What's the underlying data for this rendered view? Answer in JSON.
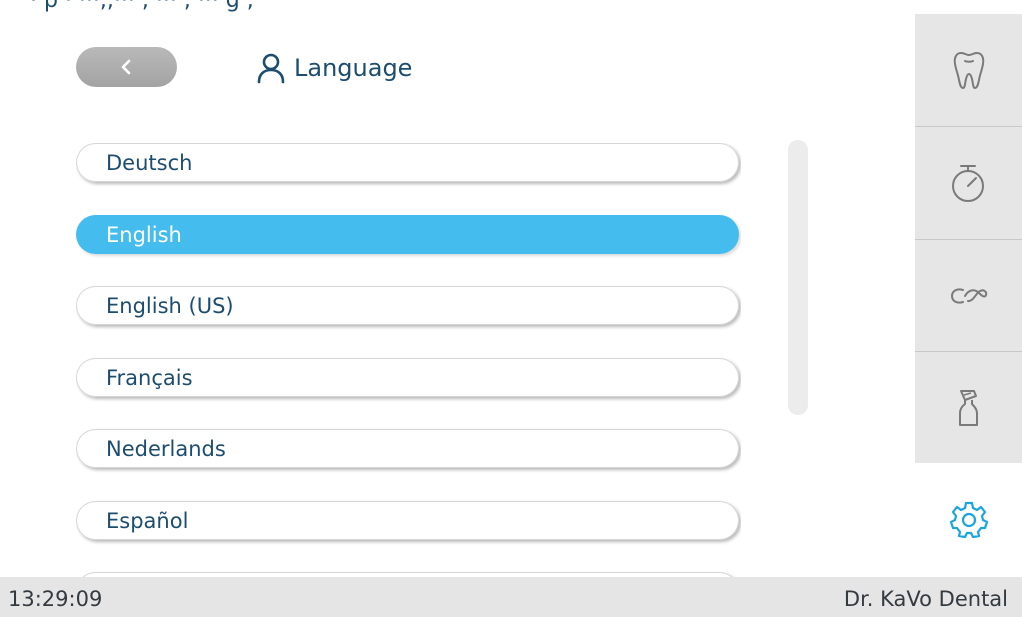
{
  "top_cut_text": "· p · ···,,··· , ··· , ··· g ,",
  "header": {
    "back_icon": "chevron-left-icon",
    "title_icon": "person-icon",
    "title": "Language"
  },
  "languages": [
    {
      "label": "Deutsch",
      "selected": false
    },
    {
      "label": "English",
      "selected": true
    },
    {
      "label": "English (US)",
      "selected": false
    },
    {
      "label": "Français",
      "selected": false
    },
    {
      "label": "Nederlands",
      "selected": false
    },
    {
      "label": "Español",
      "selected": false
    }
  ],
  "sidebar": {
    "items": [
      "tooth-icon",
      "stopwatch-icon",
      "instrument-hose-icon",
      "spray-bottle-icon"
    ],
    "active": "gear-icon"
  },
  "status_bar": {
    "time": "13:29:09",
    "user": "Dr. KaVo Dental"
  },
  "colors": {
    "selected": "#44bdee",
    "text": "#1d4d6e",
    "accent_icon": "#1aa5e0",
    "sidebar_bg": "#e6e6e6"
  }
}
